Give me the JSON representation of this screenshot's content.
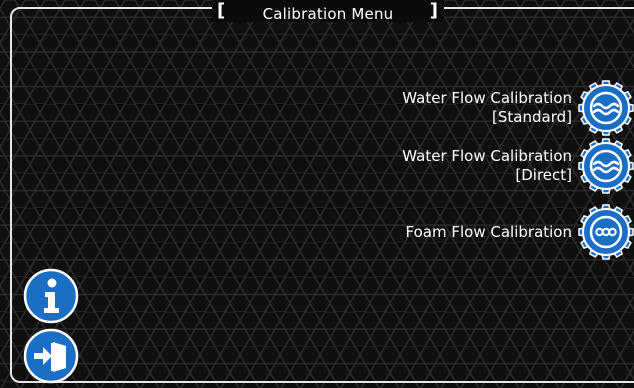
{
  "header": {
    "title": "Calibration Menu",
    "bracket_left": "[",
    "bracket_right": "]"
  },
  "menu": {
    "items": [
      {
        "line1": "Water Flow Calibration",
        "line2": "[Standard]",
        "icon": "water-gear-icon"
      },
      {
        "line1": "Water Flow Calibration",
        "line2": "[Direct]",
        "icon": "water-gear-icon"
      },
      {
        "line1": "Foam Flow Calibration",
        "line2": "",
        "icon": "foam-gear-icon"
      }
    ]
  },
  "sidebar": {
    "buttons": [
      {
        "icon": "info-icon"
      },
      {
        "icon": "exit-icon"
      }
    ]
  },
  "colors": {
    "accent_blue": "#1a6fc4",
    "frame": "#e6e6e6",
    "background": "#0b0b0b",
    "text": "#ffffff"
  }
}
